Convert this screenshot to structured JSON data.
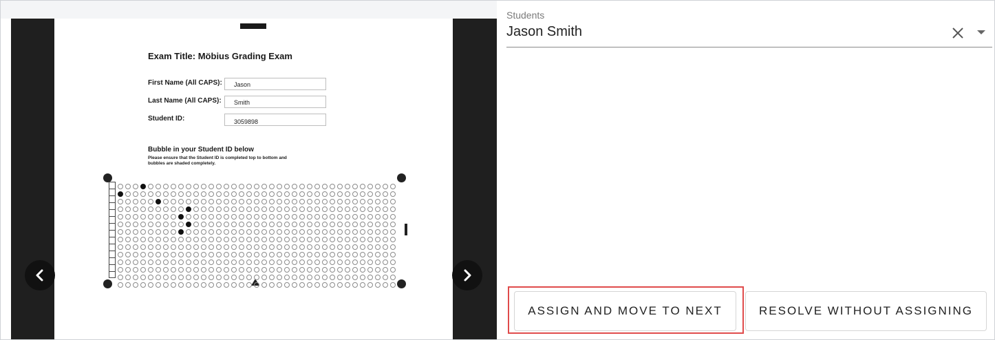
{
  "exam": {
    "title": "Exam Title: Möbius Grading Exam",
    "first_name_label": "First Name (All CAPS):",
    "first_name_value": "Jason",
    "last_name_label": "Last Name (All CAPS):",
    "last_name_value": "Smith",
    "student_id_label": "Student ID:",
    "student_id_value": "3059898",
    "bubble_title": "Bubble in your Student ID below",
    "bubble_instructions": "Please ensure that the Student ID is completed top to bottom and bubbles are shaded completely."
  },
  "viewer": {
    "prev_icon": "chevron-left-icon",
    "next_icon": "chevron-right-icon"
  },
  "students": {
    "label": "Students",
    "selected": "Jason Smith",
    "clear_icon": "close-icon",
    "dropdown_icon": "caret-down-icon"
  },
  "actions": {
    "assign_label": "ASSIGN AND MOVE TO NEXT",
    "resolve_label": "RESOLVE WITHOUT ASSIGNING"
  },
  "colors": {
    "highlight": "#e04b4b",
    "viewer_bg": "#1f1f1f"
  }
}
